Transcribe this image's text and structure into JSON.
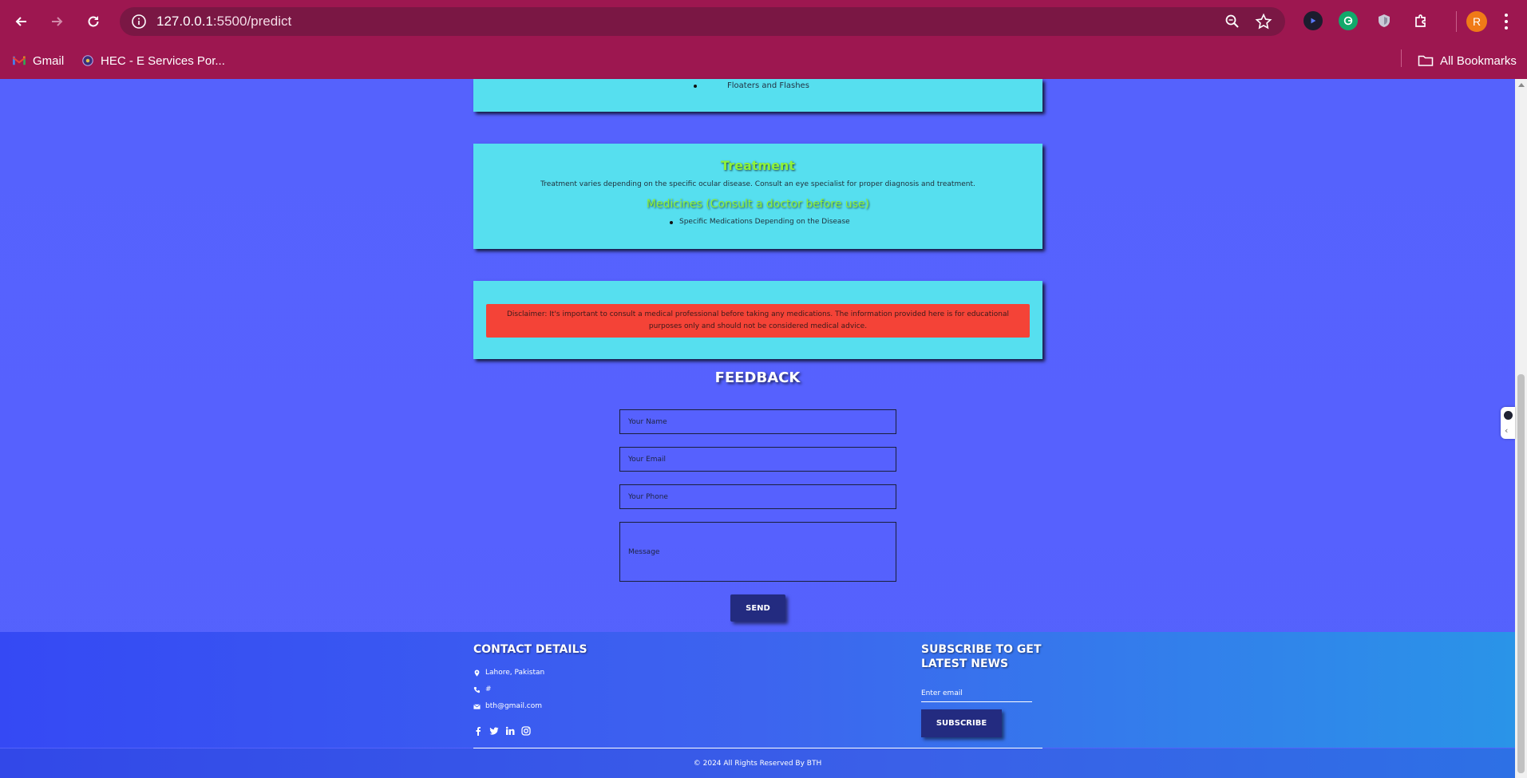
{
  "browser": {
    "url_host": "127.0.0.1",
    "url_path": ":5500/predict",
    "avatar_letter": "R",
    "bookmarks": [
      {
        "label": "Gmail",
        "icon": "gmail-icon"
      },
      {
        "label": "HEC - E Services Por...",
        "icon": "hec-icon"
      }
    ],
    "all_bookmarks_label": "All Bookmarks"
  },
  "symptoms": {
    "items": [
      "Floaters and Flashes"
    ]
  },
  "treatment": {
    "title": "Treatment",
    "text": "Treatment varies depending on the specific ocular disease. Consult an eye specialist for proper diagnosis and treatment.",
    "medicines_title": "Medicines (Consult a doctor before use)",
    "medicines": [
      "Specific Medications Depending on the Disease"
    ]
  },
  "disclaimer": {
    "text": "Disclaimer: It's important to consult a medical professional before taking any medications. The information provided here is for educational purposes only and should not be considered medical advice."
  },
  "feedback": {
    "title": "FEEDBACK",
    "name_placeholder": "Your Name",
    "email_placeholder": "Your Email",
    "phone_placeholder": "Your Phone",
    "message_placeholder": "Message",
    "send_label": "SEND"
  },
  "footer": {
    "contact_title": "CONTACT DETAILS",
    "location": "Lahore, Pakistan",
    "phone": "#",
    "email": "bth@gmail.com",
    "subscribe_title": "SUBSCRIBE TO GET LATEST NEWS",
    "subscribe_placeholder": "Enter email",
    "subscribe_label": "SUBSCRIBE",
    "copyright": "© 2024 All Rights Reserved By BTH"
  },
  "colors": {
    "chrome": "#9d1750",
    "page_bg": "#5660fb",
    "card_bg": "#56dfef",
    "accent_green": "#8ef23a",
    "disclaimer_bg": "#f44337",
    "button_bg": "#232b80"
  }
}
